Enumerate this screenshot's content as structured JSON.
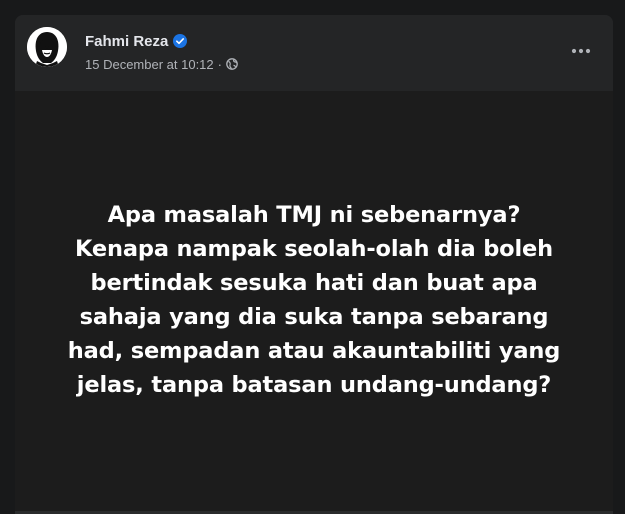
{
  "post": {
    "author": {
      "name": "Fahmi Reza",
      "verified": true
    },
    "meta": {
      "timestamp": "15 December at 10:12",
      "separator": "·",
      "audience_icon": "globe-icon"
    },
    "menu_icon": "more-horizontal-icon",
    "text_lines": [
      "Apa masalah TMJ ni sebenarnya?",
      "Kenapa nampak seolah-olah dia boleh",
      "bertindak sesuka hati dan buat apa",
      "sahaja yang dia suka tanpa sebarang",
      "had, sempadan atau akauntabiliti yang",
      "jelas, tanpa batasan undang-undang?"
    ]
  },
  "colors": {
    "page_background": "#18191a",
    "card_background": "#242526",
    "content_background": "#1c1c1c",
    "primary_text": "#e4e6eb",
    "secondary_text": "#b0b3b8",
    "verified_blue": "#1b74e4"
  }
}
